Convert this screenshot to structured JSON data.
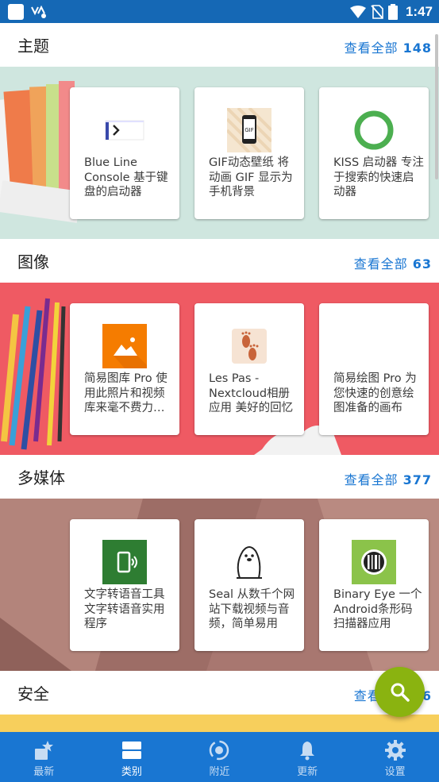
{
  "status_bar": {
    "time": "1:47"
  },
  "categories": [
    {
      "title": "主题",
      "view_all": "查看全部",
      "count": "148",
      "cards": [
        {
          "icon": "blue-line-console-icon",
          "text": "Blue Line Console 基于键盘的启动器"
        },
        {
          "icon": "gif-wallpaper-icon",
          "text": "GIF动态壁纸 将动画 GIF 显示为手机背景"
        },
        {
          "icon": "kiss-launcher-icon",
          "text": "KISS 启动器 专注于搜索的快速启动器"
        }
      ]
    },
    {
      "title": "图像",
      "view_all": "查看全部",
      "count": "63",
      "cards": [
        {
          "icon": "simple-gallery-icon",
          "text": "简易图库 Pro 使用此照片和视频库来毫不费力地管理"
        },
        {
          "icon": "les-pas-icon",
          "text": "Les Pas - Nextcloud相册应用 美好的回忆"
        },
        {
          "icon": "simple-draw-icon",
          "text": "简易绘图 Pro 为您快速的创意绘图准备的画布"
        }
      ]
    },
    {
      "title": "多媒体",
      "view_all": "查看全部",
      "count": "377",
      "cards": [
        {
          "icon": "tts-icon",
          "text": "文字转语音工具 文字转语音实用程序"
        },
        {
          "icon": "seal-icon",
          "text": "Seal 从数千个网站下载视频与音频，简单易用"
        },
        {
          "icon": "binary-eye-icon",
          "text": "Binary Eye 一个Android条形码扫描器应用"
        }
      ]
    },
    {
      "title": "安全",
      "view_all": "查看全部",
      "count": "46"
    }
  ],
  "bottom_nav": [
    {
      "label": "最新",
      "icon": "latest-icon",
      "active": false
    },
    {
      "label": "类别",
      "icon": "categories-icon",
      "active": true
    },
    {
      "label": "附近",
      "icon": "nearby-icon",
      "active": false
    },
    {
      "label": "更新",
      "icon": "updates-bell-icon",
      "active": false
    },
    {
      "label": "设置",
      "icon": "settings-gear-icon",
      "active": false
    }
  ],
  "colors": {
    "status_bar": "#1568b5",
    "bottom_nav": "#1976d2",
    "accent_link": "#1976d2",
    "fab": "#8ab310"
  }
}
